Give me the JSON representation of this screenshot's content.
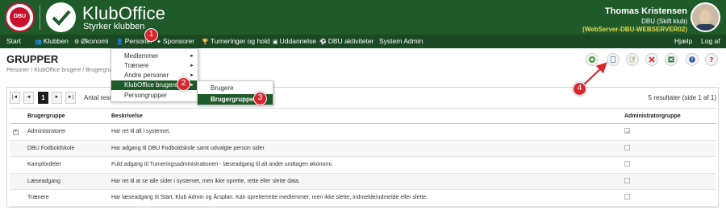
{
  "header": {
    "dbu_badge": "DBU",
    "app_title": "KlubOffice",
    "app_subtitle": "Styrker klubben",
    "user_name": "Thomas Kristensen",
    "user_club": "DBU (Skift klub)",
    "user_server": "(WebServer-DBU-WEBSERVER02)"
  },
  "nav": {
    "items": [
      "Start",
      "Klubben",
      "Økonomi",
      "Personer",
      "Sponsorer",
      "Turneringer og hold",
      "Uddannelse",
      "DBU aktiviteter",
      "System Admin"
    ],
    "help": "Hjælp",
    "logout": "Log af"
  },
  "page": {
    "title": "GRUPPER",
    "breadcrumb": "Personer / KlubOffice brugere / Brugergrupper"
  },
  "toolbar_icons": [
    "add-icon",
    "document-icon",
    "edit-icon",
    "delete-icon",
    "excel-icon",
    "help-icon",
    "question-icon"
  ],
  "pager": {
    "first": "|◄",
    "prev": "◄",
    "current": "1",
    "next": "►",
    "last": "►|",
    "antal_label": "Antal resultater",
    "results": "5 resultater (side 1 af 1)"
  },
  "table": {
    "headers": [
      "Brugergruppe",
      "Beskrivelse",
      "Administratorgruppe"
    ],
    "rows": [
      {
        "name": "Administratorer",
        "desc": "Har ret til alt i systemet.",
        "admin": true
      },
      {
        "name": "DBU Fodboldskole",
        "desc": "Har adgang til DBU Fodboldskole samt udvalgte person sider",
        "admin": false
      },
      {
        "name": "Kampfordeler",
        "desc": "Fuld adgang til Turneringsadministrationen - læseadgang til alt andet undtagen økonomi.",
        "admin": false
      },
      {
        "name": "Læseadgang",
        "desc": "Har ret til at se alle sider i systemet, men ikke oprette, rette eller slette data.",
        "admin": false
      },
      {
        "name": "Trænere",
        "desc": "Har læseadgang til Start, Klub Admin og Årsplan. Kan oprette/rette medlemmer, men ikke slette, indmelde/udmelde eller slette.",
        "admin": false
      }
    ]
  },
  "menu": {
    "level1": [
      "Medlemmer",
      "Trænere",
      "Andre personer",
      "KlubOffice brugere",
      "Persongrupper"
    ],
    "level2": [
      "Brugere",
      "Brugergrupper"
    ]
  },
  "callouts": [
    "1",
    "2",
    "3",
    "4"
  ],
  "colors": {
    "header_green": "#1f5a2a",
    "nav_green": "#1a4a23",
    "callout_red": "#d9272e",
    "server_yellow": "#e8d84a"
  }
}
